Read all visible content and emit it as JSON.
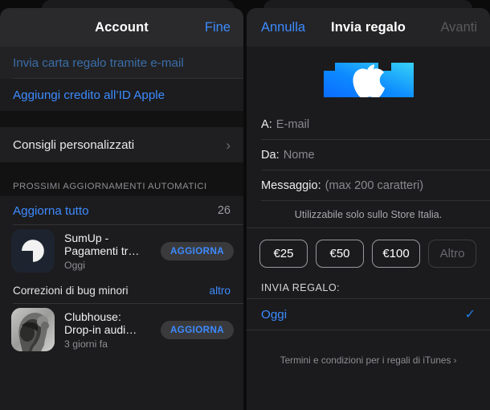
{
  "left_panel": {
    "nav": {
      "title": "Account",
      "done_label": "Fine"
    },
    "links": [
      {
        "label": "Invia carta regalo tramite e-mail",
        "state": "pressed"
      },
      {
        "label": "Aggiungi credito all’ID Apple",
        "state": "normal"
      }
    ],
    "recommendations_row": {
      "label": "Consigli personalizzati",
      "chevron": "›"
    },
    "section_header": "PROSSIMI AGGIORNAMENTI AUTOMATICI",
    "update_all": {
      "label": "Aggiorna tutto",
      "count": "26"
    },
    "apps": [
      {
        "icon": "sumup-icon",
        "name": "SumUp -\nPagamenti tr…",
        "name_line1": "SumUp -",
        "name_line2": "Pagamenti tr…",
        "subtitle": "Oggi",
        "button": "AGGIORNA",
        "note": "Correzioni di bug minori",
        "note_action": "altro"
      },
      {
        "icon": "clubhouse-icon",
        "name_line1": "Clubhouse:",
        "name_line2": "Drop-in audi…",
        "subtitle": "3 giorni fa",
        "button": "AGGIORNA"
      }
    ]
  },
  "right_panel": {
    "nav": {
      "cancel_label": "Annulla",
      "title": "Invia regalo",
      "next_label": "Avanti"
    },
    "giftcard": {
      "alt": "apple-gift-card",
      "color_start": "#0a84ff",
      "color_end": "#2bc4f3"
    },
    "fields": [
      {
        "label": "A:",
        "placeholder": "E-mail"
      },
      {
        "label": "Da:",
        "placeholder": "Nome"
      },
      {
        "label": "Messaggio:",
        "placeholder": "(max 200 caratteri)"
      }
    ],
    "store_note": "Utilizzabile solo sullo Store Italia.",
    "amounts": [
      {
        "label": "€25",
        "selectable": true
      },
      {
        "label": "€50",
        "selectable": true
      },
      {
        "label": "€100",
        "selectable": true
      },
      {
        "label": "Altro",
        "selectable": false
      }
    ],
    "send_section_header": "INVIA REGALO:",
    "send_option": {
      "label": "Oggi",
      "checked": true,
      "check_glyph": "✓"
    },
    "terms": {
      "label": "Termini e condizioni per i regali di iTunes",
      "arrow": "›"
    }
  },
  "colors": {
    "accent_blue": "#3d8bff",
    "panel_bg": "#1c1c1e",
    "nav_bg": "#2a2a2c",
    "separator": "#333335",
    "secondary_text": "#8e8e93"
  }
}
